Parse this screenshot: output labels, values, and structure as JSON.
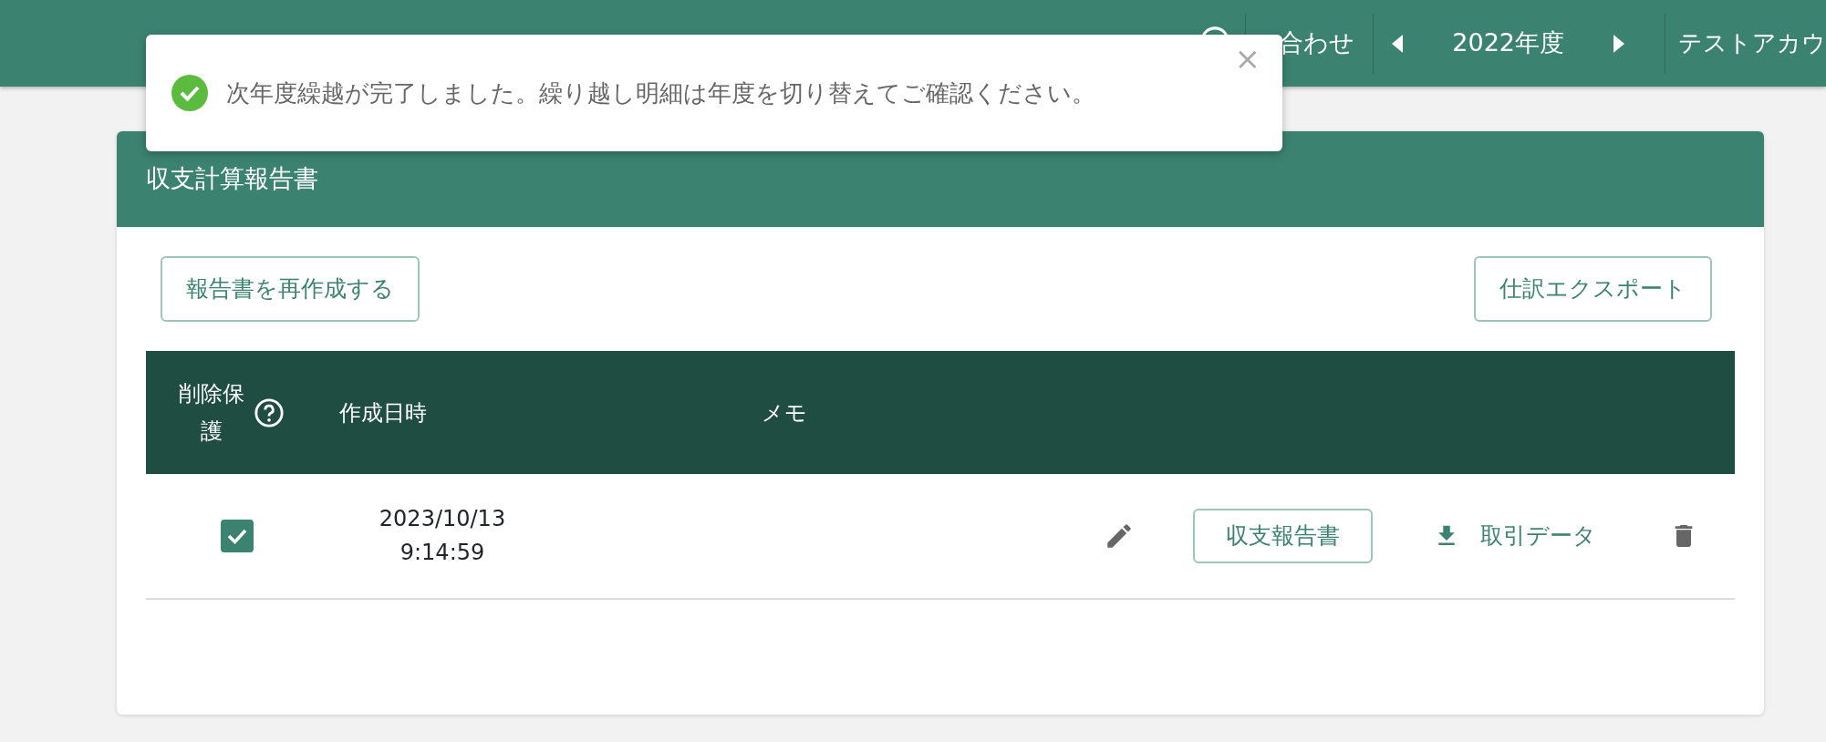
{
  "navbar": {
    "help_link": "合わせ",
    "fiscal_year": "2022年度",
    "account": "テストアカウ"
  },
  "toast": {
    "message": "次年度繰越が完了しました。繰り越し明細は年度を切り替えてご確認ください。",
    "close": "×"
  },
  "card": {
    "title": "収支計算報告書",
    "buttons": [
      "報告書を再作成する",
      "仕訳エクスポート"
    ],
    "table": {
      "columns": [
        "削除保護",
        "作成日時",
        "メモ"
      ],
      "rows": [
        {
          "checked": true,
          "date": "2023/10/13",
          "time": "9:14:59",
          "report_button": "収支報告書",
          "download_link": "取引データ"
        }
      ]
    }
  }
}
